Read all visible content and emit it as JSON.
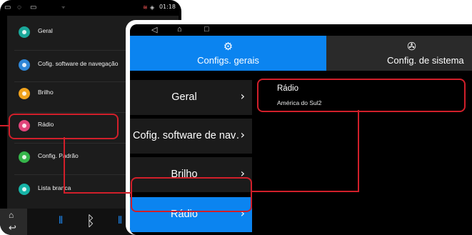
{
  "colors": {
    "accent_blue": "#0b84f0",
    "highlight_red": "#d11f2a"
  },
  "phone": {
    "status": {
      "icons": [
        "window-icon",
        "sync-icon",
        "screen-icon",
        "usb-icon"
      ],
      "right_icons": [
        "signal-icon",
        "wifi-icon"
      ],
      "time": "01:18"
    },
    "menu": [
      {
        "label": "Geral",
        "icon": "geral-icon",
        "color": "#1aa89a"
      },
      {
        "label": "Cofig. software de navegação",
        "icon": "navigation-icon",
        "color": "#2f86d6"
      },
      {
        "label": "Brilho",
        "icon": "brightness-icon",
        "color": "#f0a21c"
      },
      {
        "label": "Rádio",
        "icon": "radio-icon",
        "color": "#e0447a"
      },
      {
        "label": "Config. Padrão",
        "icon": "default-config-icon",
        "color": "#35b54a"
      },
      {
        "label": "Lista branca",
        "icon": "whitelist-icon",
        "color": "#16b3a6"
      }
    ],
    "nav": {
      "home": "home-icon",
      "back": "back-icon",
      "equalizer": "equalizer-icon",
      "bluetooth": "bluetooth-icon",
      "volume": "volume-icon"
    }
  },
  "tablet": {
    "tabs": [
      {
        "label": "Configs. gerais",
        "icon": "settings-gear-icon",
        "active": true
      },
      {
        "label": "Config. de sistema",
        "icon": "system-config-icon",
        "active": false
      }
    ],
    "menu": [
      {
        "label": "Geral"
      },
      {
        "label": "Cofig. software de nav…"
      },
      {
        "label": "Brilho"
      },
      {
        "label": "Rádio"
      }
    ],
    "chevron": "›",
    "detail": {
      "title": "Rádio",
      "value": "América do Sul2"
    }
  }
}
